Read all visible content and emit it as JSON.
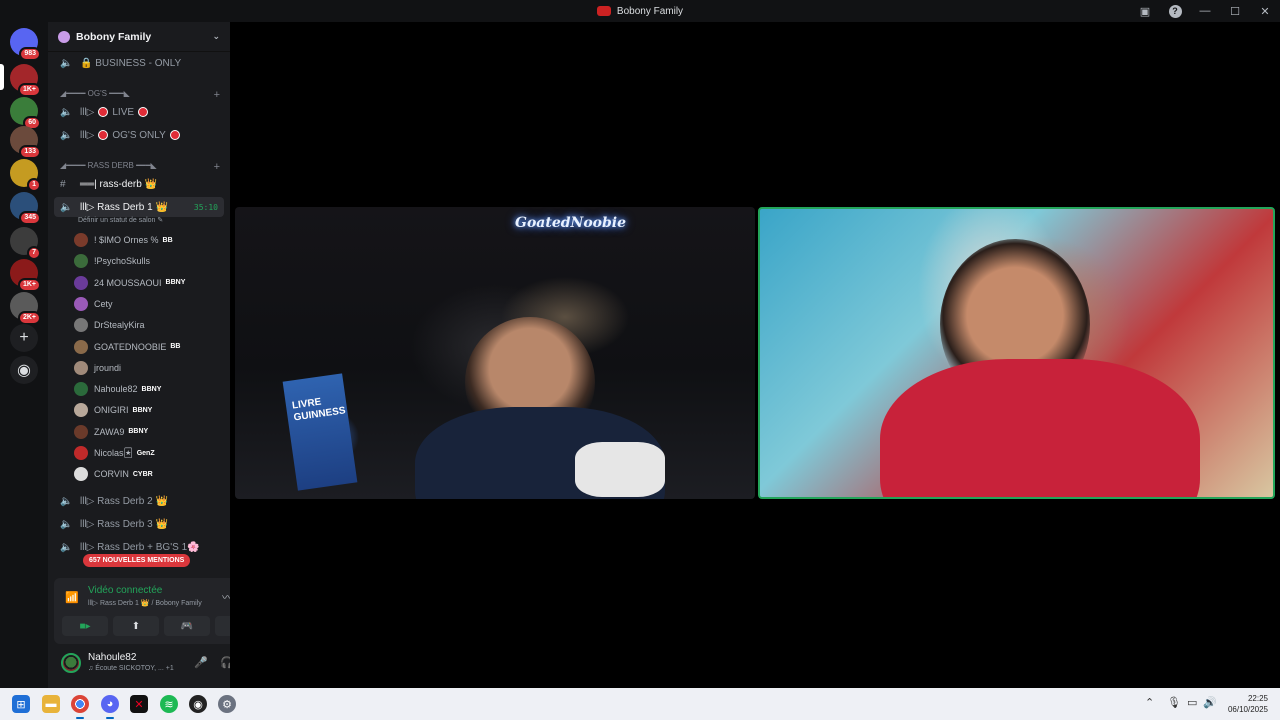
{
  "window": {
    "title": "Bobony Family"
  },
  "rail": {
    "servers": [
      {
        "name": "discord-home",
        "badge": "983",
        "color": "#5865f2"
      },
      {
        "name": "server-1",
        "badge": "1K+",
        "color": "#a3262a"
      },
      {
        "name": "server-2",
        "badge": "60",
        "color": "#3a7d3a"
      },
      {
        "name": "server-3",
        "badge": "133",
        "color": "#6b4a3c"
      },
      {
        "name": "server-4",
        "badge": "1",
        "color": "#c59b21"
      },
      {
        "name": "server-5",
        "badge": "345",
        "color": "#2b4f7a"
      },
      {
        "name": "server-6",
        "badge": "7",
        "color": "#3c3c3c"
      },
      {
        "name": "server-7",
        "badge": "1K+",
        "color": "#8b1a1a"
      },
      {
        "name": "server-8",
        "badge": "2K+",
        "color": "#5a5a5a"
      }
    ]
  },
  "sidebar": {
    "server_name": "Bobony Family",
    "channels_top": [
      {
        "label": "BUSINESS - ONLY"
      }
    ],
    "category_ogs": "◢━━━━ OG'S ━━━◣",
    "ogs_channels": [
      {
        "prefix": "lll▷",
        "label": "LIVE"
      },
      {
        "prefix": "lll▷",
        "label": "OG'S ONLY"
      }
    ],
    "category_rass": "◢━━━━ RASS DERB ━━━◣",
    "text_channel": "══| rass-derb 👑",
    "active_voice": {
      "label": "lll▷ Rass Derb 1 👑",
      "time": "35:10",
      "status_placeholder": "Définir un statut de salon"
    },
    "members": [
      {
        "name": "! $IMO Ornes %",
        "tag": "BB",
        "color": "#7a3b2b"
      },
      {
        "name": "!PsychoSkulls",
        "tag": "",
        "color": "#3b6b3b"
      },
      {
        "name": "24 MOUSSAOUI",
        "tag": "BBNY",
        "color": "#6a3b9a"
      },
      {
        "name": "Cety",
        "tag": "",
        "color": "#9a5ab8"
      },
      {
        "name": "DrStealyKira",
        "tag": "",
        "color": "#777"
      },
      {
        "name": "GOATEDNOOBIE",
        "tag": "BB",
        "color": "#8a6a4a"
      },
      {
        "name": "jroundi",
        "tag": "",
        "color": "#a08a7a"
      },
      {
        "name": "Nahoule82",
        "tag": "BBNY",
        "color": "#2b6a3b"
      },
      {
        "name": "ONIGIRI",
        "tag": "BBNY",
        "color": "#b8a89a"
      },
      {
        "name": "ZAWA9",
        "tag": "BBNY",
        "color": "#6a3a2a"
      },
      {
        "name": "Nicolas🃏",
        "tag": "GenZ",
        "color": "#c02a2a"
      },
      {
        "name": "CORVIN",
        "tag": "CYBR",
        "color": "#dcdcdc"
      }
    ],
    "voice_channels_more": [
      {
        "label": "lll▷ Rass Derb 2 👑"
      },
      {
        "label": "lll▷ Rass Derb 3 👑"
      },
      {
        "label": "lll▷ Rass Derb + BG'S 1🌸"
      }
    ],
    "mentions_banner": "657 NOUVELLES MENTIONS"
  },
  "voice_panel": {
    "status": "Vidéo connectée",
    "location": "lll▷ Rass Derb 1 👑 / Bobony Family"
  },
  "user_panel": {
    "name": "Nahoule82",
    "activity": "♫ Écoute SICKOTOY, ...  +1"
  },
  "stage": {
    "tile1_label": "GoatedNoobie",
    "book_label": "LIVRE GUINNESS"
  },
  "taskbar": {
    "time": "22:25",
    "date": "06/10/2025"
  }
}
